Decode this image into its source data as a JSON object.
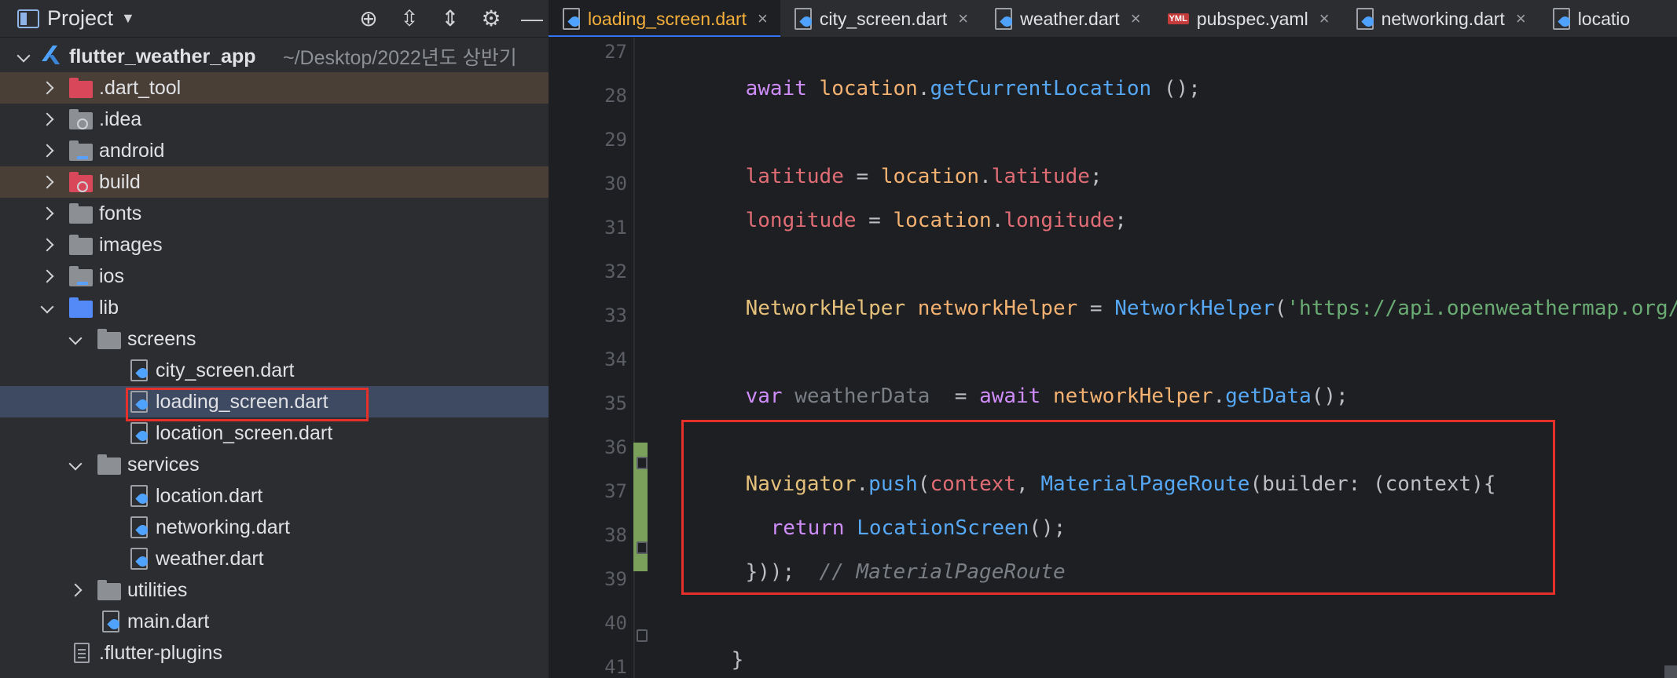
{
  "project_panel": {
    "title": "Project",
    "tool_icons": [
      "locate-icon",
      "expand-all-icon",
      "collapse-all-icon",
      "gear-icon",
      "minimize-icon"
    ]
  },
  "tree": {
    "root": {
      "name": "flutter_weather_app",
      "path": "~/Desktop/2022년도 상반기"
    },
    "items": [
      {
        "label": ".dart_tool"
      },
      {
        "label": ".idea"
      },
      {
        "label": "android"
      },
      {
        "label": "build"
      },
      {
        "label": "fonts"
      },
      {
        "label": "images"
      },
      {
        "label": "ios"
      },
      {
        "label": "lib"
      },
      {
        "label": "screens"
      },
      {
        "label": "city_screen.dart"
      },
      {
        "label": "loading_screen.dart"
      },
      {
        "label": "location_screen.dart"
      },
      {
        "label": "services"
      },
      {
        "label": "location.dart"
      },
      {
        "label": "networking.dart"
      },
      {
        "label": "weather.dart"
      },
      {
        "label": "utilities"
      },
      {
        "label": "main.dart"
      },
      {
        "label": ".flutter-plugins"
      }
    ]
  },
  "tabs": [
    {
      "label": "loading_screen.dart",
      "close": "×"
    },
    {
      "label": "city_screen.dart",
      "close": "×"
    },
    {
      "label": "weather.dart",
      "close": "×"
    },
    {
      "label": "pubspec.yaml",
      "close": "×",
      "badge": "YML"
    },
    {
      "label": "networking.dart",
      "close": "×"
    },
    {
      "label": "locatio",
      "close": ""
    }
  ],
  "editor": {
    "line_numbers": [
      "27",
      "28",
      "29",
      "30",
      "31",
      "32",
      "33",
      "34",
      "35",
      "36",
      "37",
      "38",
      "39",
      "40",
      "41"
    ],
    "lines": {
      "l27": {
        "t1": "await",
        "t2": " location",
        "t3": ".",
        "t4": "getCurrentLocation",
        "t5": " ();"
      },
      "l29": {
        "t1": "latitude",
        "t2": " = ",
        "t3": "location",
        "t4": ".",
        "t5": "latitude",
        "t6": ";"
      },
      "l30": {
        "t1": "longitude",
        "t2": " = ",
        "t3": "location",
        "t4": ".",
        "t5": "longitude",
        "t6": ";"
      },
      "l32": {
        "t1": "NetworkHelper",
        "t2": " networkHelper",
        "t3": " = ",
        "t4": "NetworkHelper",
        "t5": "(",
        "t6": "'https://api.openweathermap.org/da"
      },
      "l34": {
        "t1": "var",
        "t2": " weatherData",
        "t3": "  = ",
        "t4": "await",
        "t5": " networkHelper",
        "t6": ".",
        "t7": "getData",
        "t8": "();"
      },
      "l36": {
        "t1": "Navigator",
        "t2": ".",
        "t3": "push",
        "t4": "(",
        "t5": "context",
        "t6": ", ",
        "t7": "MaterialPageRoute",
        "t8": "(builder: (context){"
      },
      "l37": {
        "t1": "return",
        "t2": " LocationScreen",
        "t3": "();"
      },
      "l38": {
        "t1": "}));",
        "t2": "  // MaterialPageRoute"
      },
      "l40": {
        "t1": "}"
      }
    }
  }
}
